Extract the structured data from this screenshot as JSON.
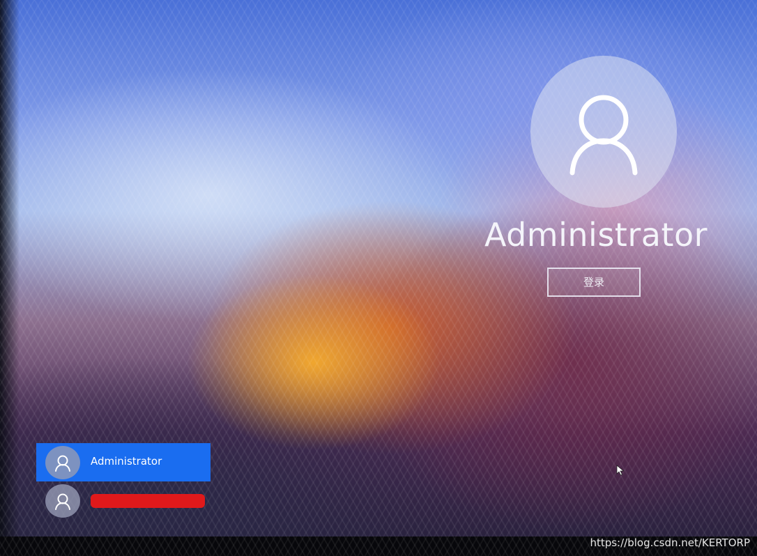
{
  "lock_screen": {
    "selected_user": "Administrator",
    "sign_in_label": "登录"
  },
  "user_list": [
    {
      "name": "Administrator",
      "selected": true
    },
    {
      "name": "",
      "selected": false,
      "redacted": true
    }
  ],
  "colors": {
    "selected_user_bg": "#1a6df0",
    "redaction": "#e0191b"
  },
  "icons": {
    "large_avatar": "user-avatar-icon",
    "small_avatar": "user-avatar-icon",
    "pointer": "mouse-pointer-icon"
  },
  "watermark": "https://blog.csdn.net/KERTORP"
}
